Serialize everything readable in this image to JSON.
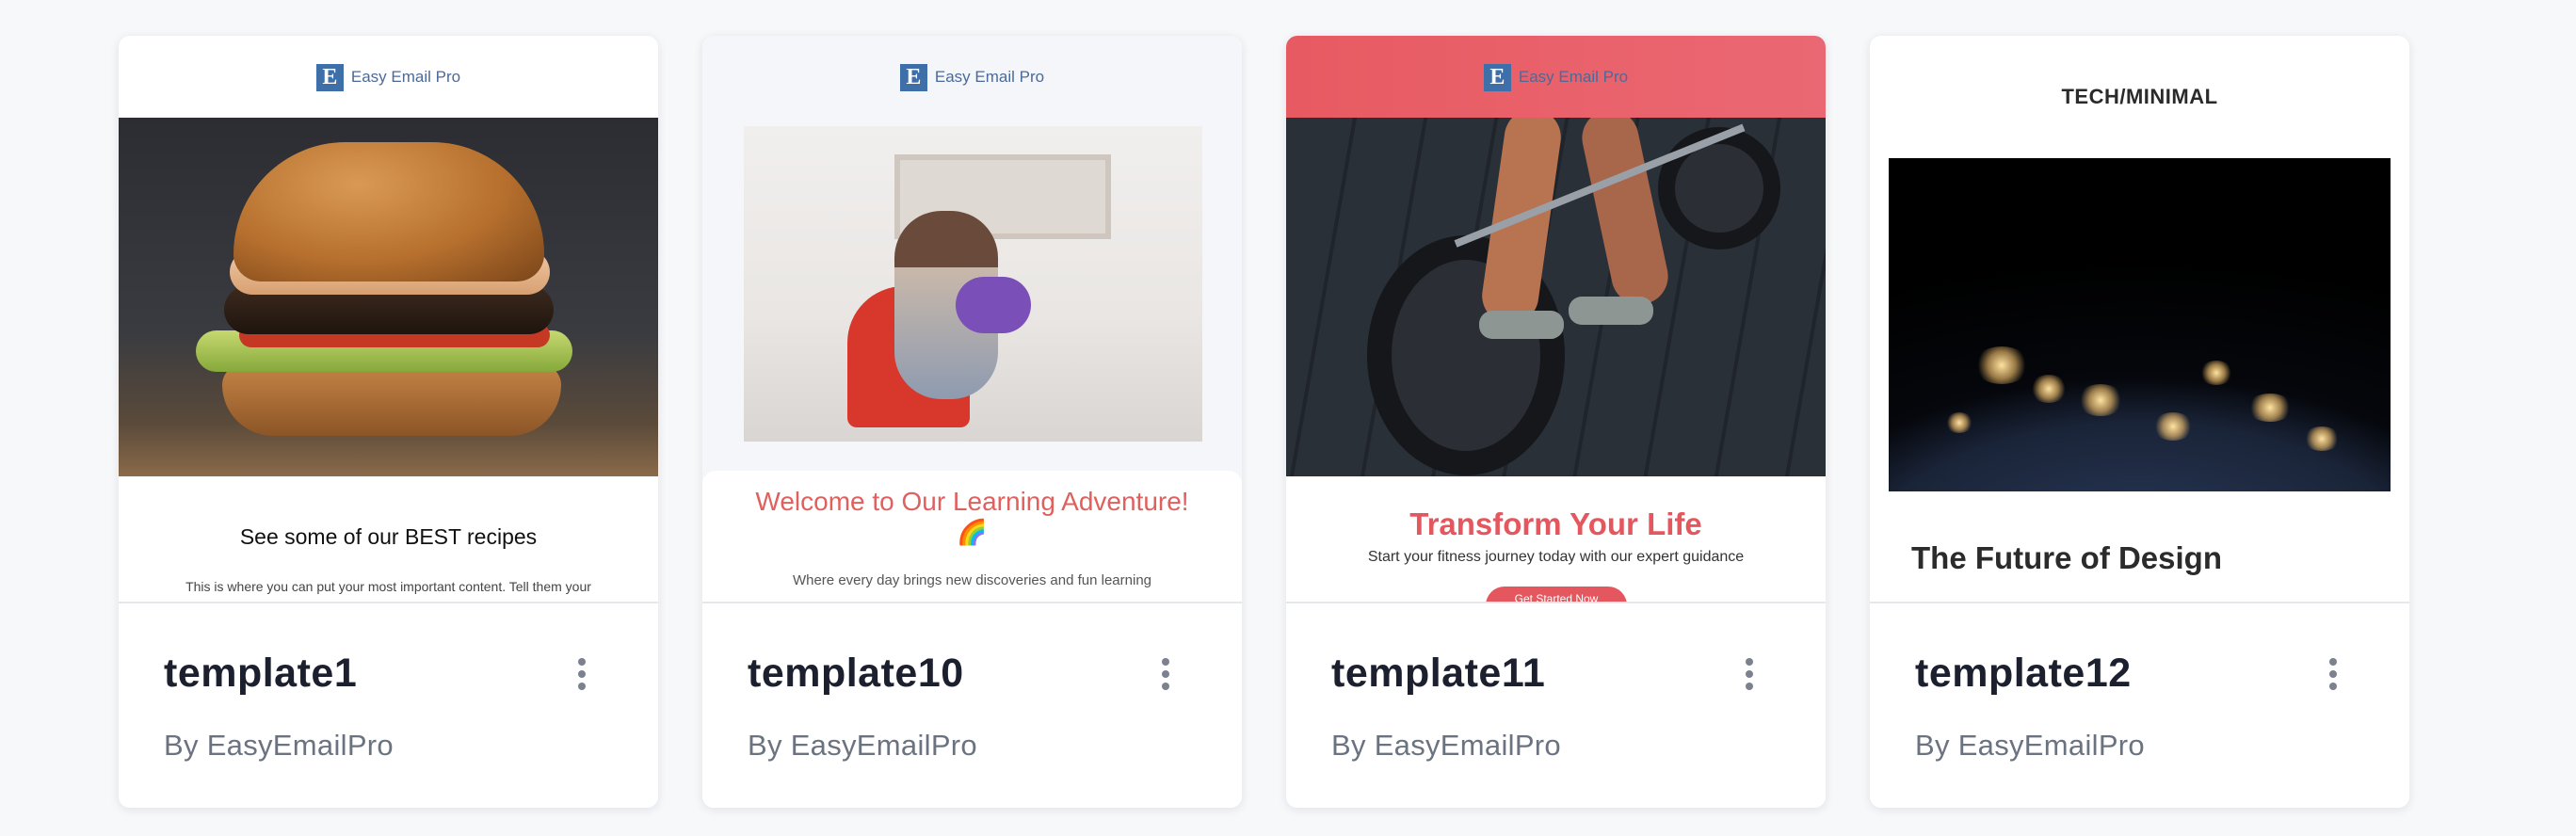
{
  "cards": [
    {
      "name": "template1",
      "author": "By EasyEmailPro",
      "brand": "Easy Email Pro",
      "brand_letter": "E",
      "headline": "See some of our BEST recipes",
      "body": "This is where you can put your most important content. Tell them your"
    },
    {
      "name": "template10",
      "author": "By EasyEmailPro",
      "brand": "Easy Email Pro",
      "brand_letter": "E",
      "headline": "Welcome to Our Learning Adventure!",
      "emoji": "🌈",
      "body": "Where every day brings new discoveries and fun learning"
    },
    {
      "name": "template11",
      "author": "By EasyEmailPro",
      "brand": "Easy Email Pro",
      "brand_letter": "E",
      "headline": "Transform Your Life",
      "body": "Start your fitness journey today with our expert guidance",
      "cta": "Get Started Now"
    },
    {
      "name": "template12",
      "author": "By EasyEmailPro",
      "label": "TECH/MINIMAL",
      "headline": "The Future of Design"
    }
  ],
  "icons": {
    "menu": "more-vertical-icon",
    "brand_logo": "easy-email-pro-logo"
  },
  "colors": {
    "accent_red": "#e5575f",
    "accent_coral": "#e0605e",
    "brand_blue": "#3f6fa8",
    "title_text": "#1b1f2e",
    "muted_text": "#6b7280"
  }
}
